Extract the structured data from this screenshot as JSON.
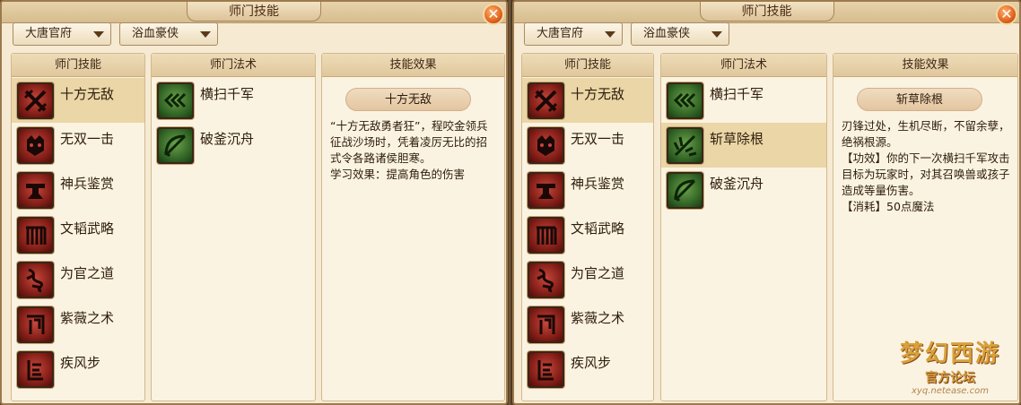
{
  "window_title": "师门技能",
  "close_glyph": "✕",
  "colors": {
    "panel_bg": "#f6ead3",
    "selected_row": "#ead6a6",
    "skill_icon": "#8a1f18",
    "spell_icon": "#2f6a24"
  },
  "left_panel": {
    "dropdown_sect": "大唐官府",
    "dropdown_style": "浴血豪侠",
    "headers": {
      "skills": "师门技能",
      "spells": "师门法术",
      "effect": "技能效果"
    },
    "skills": [
      {
        "label": "十方无敌",
        "icon": "crossed-swords-icon",
        "selected": true
      },
      {
        "label": "无双一击",
        "icon": "beast-head-icon",
        "selected": false
      },
      {
        "label": "神兵鉴赏",
        "icon": "anvil-icon",
        "selected": false
      },
      {
        "label": "文韬武略",
        "icon": "fence-icon",
        "selected": false
      },
      {
        "label": "为官之道",
        "icon": "scroll-knot-icon",
        "selected": false
      },
      {
        "label": "紫薇之术",
        "icon": "seal-icon",
        "selected": false
      },
      {
        "label": "疾风步",
        "icon": "steps-icon",
        "selected": false
      }
    ],
    "spells": [
      {
        "label": "横扫千军",
        "icon": "triple-chevron-icon",
        "selected": false
      },
      {
        "label": "破釜沉舟",
        "icon": "bow-icon",
        "selected": false
      }
    ],
    "effect_title": "十方无敌",
    "effect_text": "“十方无敌勇者狂”，程咬金领兵征战沙场时，凭着凌厉无比的招式令各路诸侯胆寒。\n学习效果：提高角色的伤害"
  },
  "right_panel": {
    "dropdown_sect": "大唐官府",
    "dropdown_style": "浴血豪侠",
    "headers": {
      "skills": "师门技能",
      "spells": "师门法术",
      "effect": "技能效果"
    },
    "skills": [
      {
        "label": "十方无敌",
        "icon": "crossed-swords-icon",
        "selected": true
      },
      {
        "label": "无双一击",
        "icon": "beast-head-icon",
        "selected": false
      },
      {
        "label": "神兵鉴赏",
        "icon": "anvil-icon",
        "selected": false
      },
      {
        "label": "文韬武略",
        "icon": "fence-icon",
        "selected": false
      },
      {
        "label": "为官之道",
        "icon": "scroll-knot-icon",
        "selected": false
      },
      {
        "label": "紫薇之术",
        "icon": "seal-icon",
        "selected": false
      },
      {
        "label": "疾风步",
        "icon": "steps-icon",
        "selected": false
      }
    ],
    "spells": [
      {
        "label": "横扫千军",
        "icon": "triple-chevron-icon",
        "selected": false
      },
      {
        "label": "斩草除根",
        "icon": "slash-grass-icon",
        "selected": true
      },
      {
        "label": "破釜沉舟",
        "icon": "bow-icon",
        "selected": false
      }
    ],
    "effect_title": "斩草除根",
    "effect_text": "刃锋过处，生机尽断，不留余孽，绝祸根源。\n【功效】你的下一次横扫千军攻击目标为玩家时，对其召唤兽或孩子造成等量伤害。\n【消耗】50点魔法"
  },
  "watermark": {
    "logo": "梦幻西游",
    "subtitle": "官方论坛",
    "url": "xyq.netease.com"
  }
}
